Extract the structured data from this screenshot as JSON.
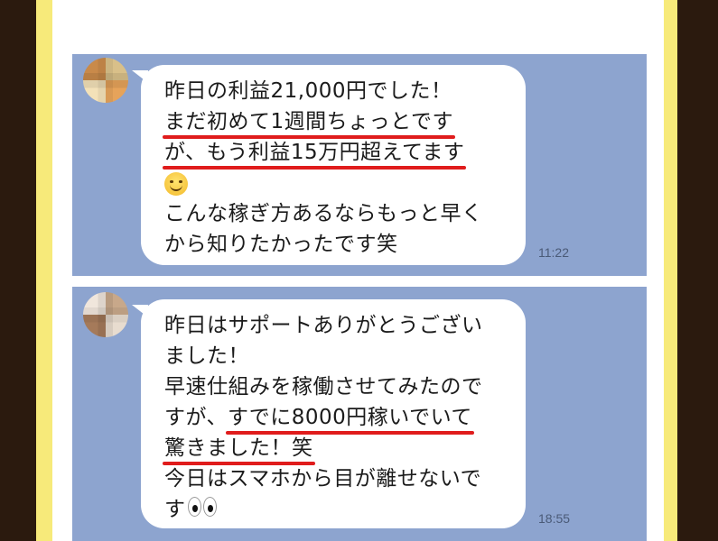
{
  "messages": [
    {
      "lines": {
        "l1": "昨日の利益21,000円でした！",
        "l2": "まだ初めて1週間ちょっとです",
        "l3": "が、もう利益15万円超えてます",
        "l4_emoji": "smiling-face",
        "l5": "こんな稼ぎ方あるならもっと早く",
        "l6": "から知りたかったです笑"
      },
      "time": "11:22"
    },
    {
      "lines": {
        "l1": "昨日はサポートありがとうござい",
        "l2": "ました！",
        "l3": "早速仕組みを稼働させてみたので",
        "l4_pre": "すが、",
        "l4_u": "すでに8000円稼いでいて",
        "l5_u": "驚きました！笑",
        "l6": "今日はスマホから目が離せないで",
        "l7": "す",
        "l7_emoji": "eyes"
      },
      "time": "18:55"
    }
  ],
  "colors": {
    "chat_background": "#8da4cf",
    "bubble": "#ffffff",
    "underline": "#e01c1c",
    "outer_frame": "#2b1a0e",
    "yellow_border": "#f7ea7a"
  }
}
